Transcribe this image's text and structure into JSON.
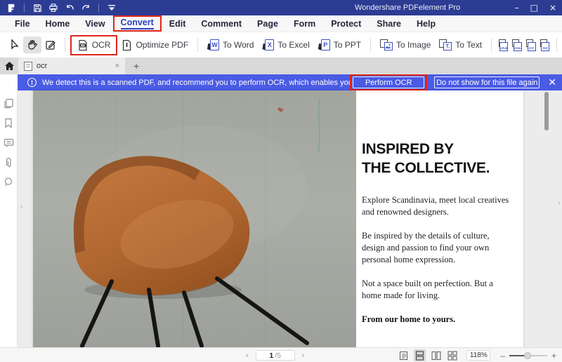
{
  "window": {
    "title": "Wondershare PDFelement Pro",
    "minimize": "–",
    "maximize": "□",
    "close": "×"
  },
  "menu_bar": {
    "items": [
      "File",
      "Home",
      "View",
      "Convert",
      "Edit",
      "Comment",
      "Page",
      "Form",
      "Protect",
      "Share",
      "Help"
    ],
    "active_item": "Convert"
  },
  "toolbar": {
    "ocr_label": "OCR",
    "ocr_icon_text": "OCR",
    "optimize_label": "Optimize PDF",
    "to_word_label": "To Word",
    "to_excel_label": "To Excel",
    "to_ppt_label": "To PPT",
    "to_image_label": "To Image",
    "to_text_label": "To Text",
    "word_letter": "W",
    "excel_letter": "X",
    "ppt_letter": "P",
    "text_letter": "T.",
    "mini_formats": [
      "EPUB",
      "HTML",
      "RTF",
      "PDF"
    ]
  },
  "tab_bar": {
    "active_tab_label": "ocr",
    "tab_close": "×",
    "add_tab": "+"
  },
  "notification": {
    "info_glyph": "!",
    "message": "We detect this is a scanned PDF, and recommend you to perform OCR, which enables you to ...",
    "perform_button": "Perform OCR",
    "dismiss_button": "Do not show for this file again",
    "close": "✕"
  },
  "pdf_page": {
    "headline_line1": "INSPIRED BY",
    "headline_line2": "THE COLLECTIVE.",
    "paragraph1_line1": "Explore Scandinavia, meet local creatives",
    "paragraph1_line2": "and renowned designers.",
    "paragraph2_line1": "Be inspired by the details of culture,",
    "paragraph2_line2": "design and passion to find your own",
    "paragraph2_line3": "personal home expression.",
    "paragraph3_line1": "Not a space built on perfection. But a",
    "paragraph3_line2": "home made for living.",
    "closing": "From our home to yours."
  },
  "status_bar": {
    "prev_glyph": "‹",
    "next_glyph": "›",
    "page_current": "1",
    "page_total": "/5",
    "zoom_level": "118%",
    "zoom_minus": "–",
    "zoom_plus": "+"
  },
  "panel_arrows": {
    "left": "›",
    "right": "‹"
  },
  "colors": {
    "titlebar": "#2d3c93",
    "notification_blue": "#4a5be4",
    "annotation_red": "#e0261c",
    "accent_blue": "#2b41bc"
  }
}
